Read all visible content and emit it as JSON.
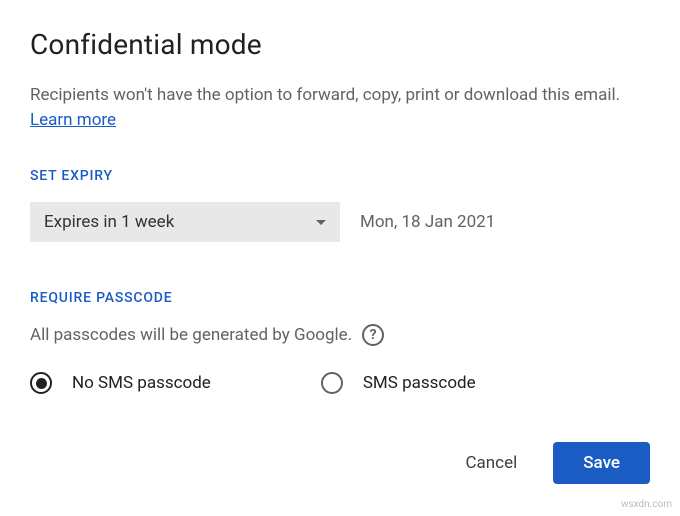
{
  "dialog": {
    "title": "Confidential mode",
    "description": "Recipients won't have the option to forward, copy, print or download this email. ",
    "learn_more": "Learn more"
  },
  "expiry": {
    "section_label": "SET EXPIRY",
    "selected": "Expires in 1 week",
    "date": "Mon, 18 Jan 2021"
  },
  "passcode": {
    "section_label": "REQUIRE PASSCODE",
    "description": "All passcodes will be generated by Google.",
    "help_symbol": "?",
    "options": {
      "no_sms": "No SMS passcode",
      "sms": "SMS passcode"
    },
    "selected": "no_sms"
  },
  "buttons": {
    "cancel": "Cancel",
    "save": "Save"
  },
  "watermark": "wsxdn.com"
}
